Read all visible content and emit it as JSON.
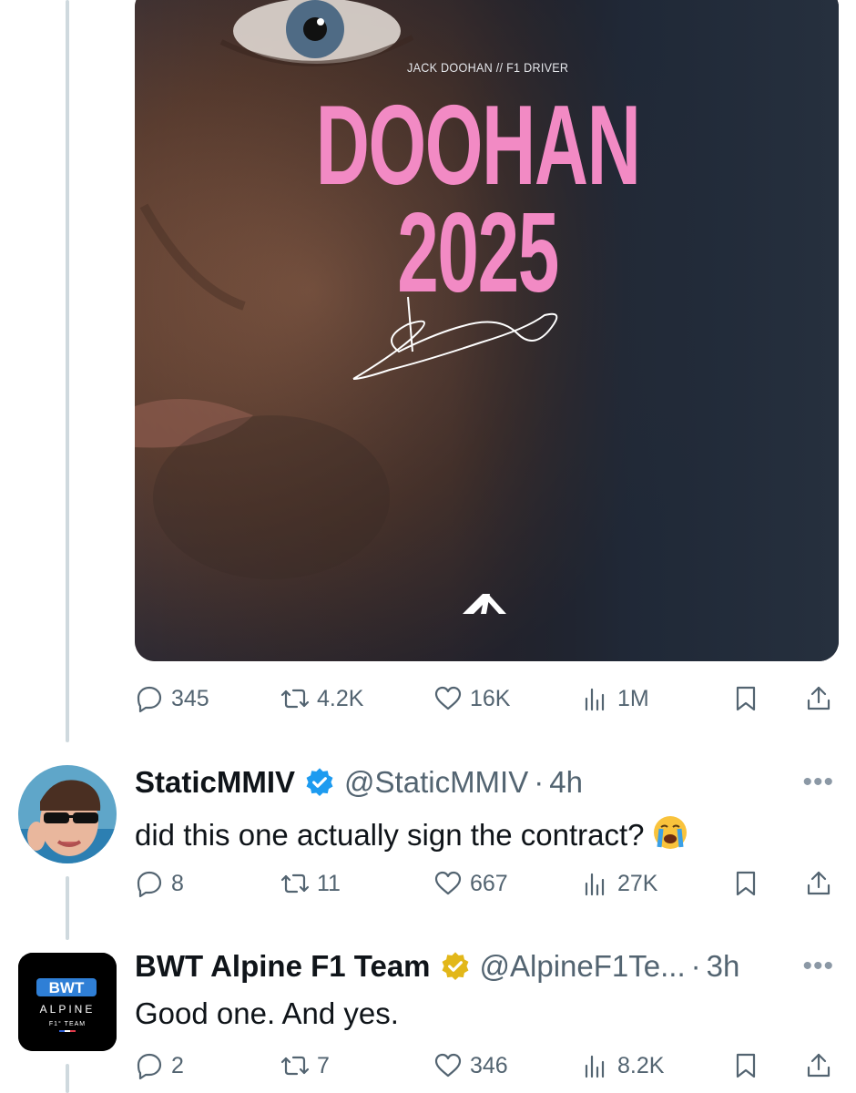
{
  "poster": {
    "kicker": "JACK DOOHAN // F1 DRIVER",
    "title_line1": "DOOHAN",
    "title_line2": "2025",
    "accent_color": "#f28ac4",
    "logo_icon": "alpine-logo-icon"
  },
  "main_post": {
    "actions": {
      "replies": "345",
      "reposts": "4.2K",
      "likes": "16K",
      "views": "1M"
    }
  },
  "replies": [
    {
      "name": "StaticMMIV",
      "verified": "blue",
      "handle": "@StaticMMIV",
      "time": "4h",
      "text": "did this one actually sign the contract?",
      "emoji": "loudly-crying-face",
      "actions": {
        "replies": "8",
        "reposts": "11",
        "likes": "667",
        "views": "27K"
      }
    },
    {
      "name": "BWT Alpine F1 Team",
      "verified": "gold",
      "handle": "@AlpineF1Te...",
      "time": "3h",
      "text": "Good one. And yes.",
      "actions": {
        "replies": "2",
        "reposts": "7",
        "likes": "346",
        "views": "8.2K"
      },
      "avatar": {
        "line1": "BWT",
        "line2": "ALPINE",
        "line3": "F1° TEAM"
      }
    }
  ],
  "ui": {
    "dot": "·",
    "more": "•••"
  },
  "colors": {
    "muted": "#536471",
    "blue_check": "#1d9bf0",
    "gold_check": "#e2b719"
  }
}
